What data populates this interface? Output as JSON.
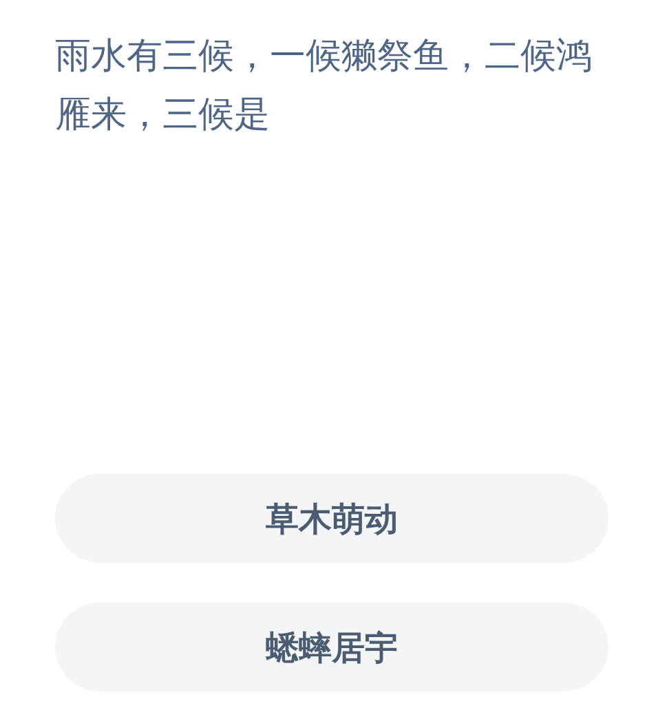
{
  "question": "雨水有三候，一候獭祭鱼，二候鸿雁来，三候是",
  "options": [
    {
      "label": "草木萌动"
    },
    {
      "label": "蟋蟀居宇"
    }
  ]
}
